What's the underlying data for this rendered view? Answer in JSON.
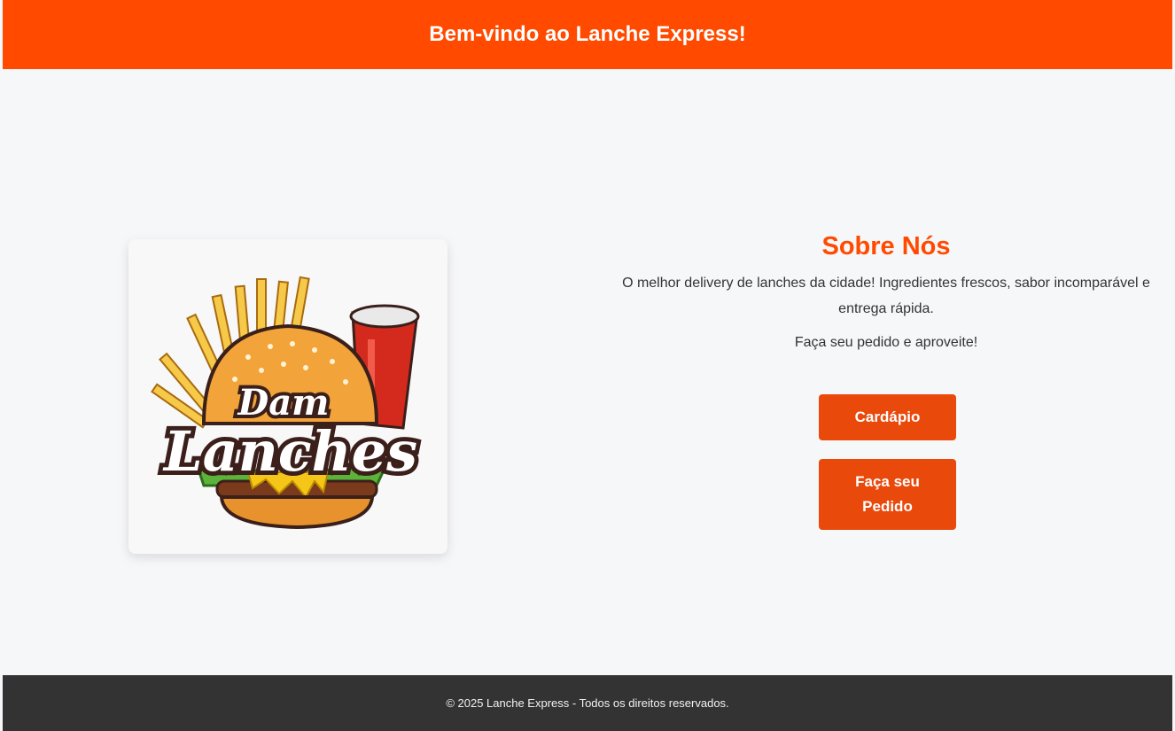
{
  "header": {
    "title": "Bem-vindo ao Lanche Express!"
  },
  "logo": {
    "line1": "Dam",
    "line2": "Lanches",
    "colors": {
      "bun": "#f2a43a",
      "fries": "#f7c948",
      "cup": "#d42a1e",
      "lettuce": "#5bb33a",
      "text_outline": "#3b1f1a"
    }
  },
  "about": {
    "title": "Sobre Nós",
    "paragraph1": "O melhor delivery de lanches da cidade! Ingredientes frescos, sabor incomparável e entrega rápida.",
    "paragraph2": "Faça seu pedido e aproveite!"
  },
  "buttons": {
    "menu_label": "Cardápio",
    "order_label": "Faça seu Pedido"
  },
  "footer": {
    "text": "© 2025 Lanche Express - Todos os direitos reservados."
  },
  "colors": {
    "brand": "#ff4a00",
    "button": "#e94a0c",
    "footer": "#333333",
    "background": "#f6f7f9"
  }
}
